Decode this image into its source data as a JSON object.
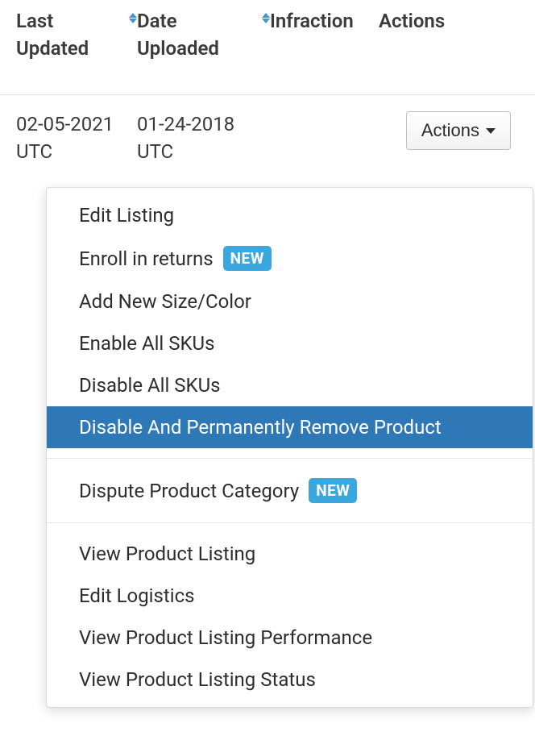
{
  "table": {
    "headers": {
      "last_updated": "Last Updated",
      "date_uploaded": "Date Uploaded",
      "infraction": "Infraction",
      "actions": "Actions"
    },
    "row": {
      "last_updated": "02-05-2021 UTC",
      "date_uploaded": "01-24-2018 UTC",
      "infraction": "",
      "actions_button": "Actions"
    }
  },
  "dropdown": {
    "items": {
      "edit_listing": "Edit Listing",
      "enroll_returns": "Enroll in returns",
      "add_size_color": "Add New Size/Color",
      "enable_all_skus": "Enable All SKUs",
      "disable_all_skus": "Disable All SKUs",
      "disable_remove": "Disable And Permanently Remove Product",
      "dispute_category": "Dispute Product Category",
      "view_listing": "View Product Listing",
      "edit_logistics": "Edit Logistics",
      "view_performance": "View Product Listing Performance",
      "view_status": "View Product Listing Status"
    },
    "badge_new": "NEW"
  }
}
